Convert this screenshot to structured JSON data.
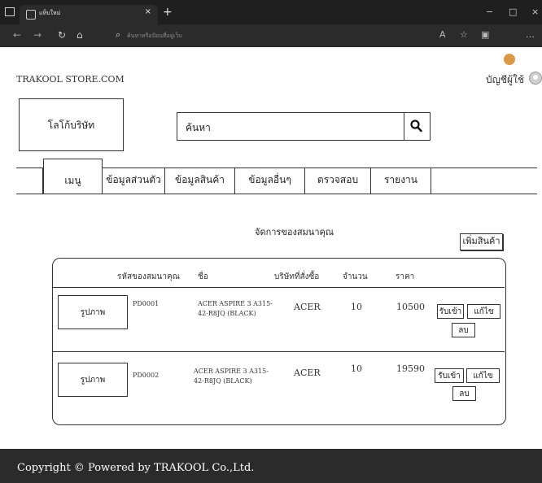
{
  "browser": {
    "tab_title": "แท็บใหม่",
    "tab_close": "×",
    "new_tab": "+",
    "address_placeholder": "ค้นหาหรือป้อนที่อยู่เว็บ",
    "window_controls": [
      "−",
      "□",
      "×"
    ]
  },
  "header": {
    "store_name": "TRAKOOL STORE.COM",
    "account_label": "บัญชีผู้ใช้"
  },
  "logo": {
    "label": "โลโก้บริษัท"
  },
  "search": {
    "value": "ค้นหา"
  },
  "nav": {
    "tabs": [
      {
        "label": "เมนู"
      },
      {
        "label": "ข้อมูลส่วนตัว"
      },
      {
        "label": "ข้อมูลสินค้า"
      },
      {
        "label": "ข้อมูลอื่นๆ"
      },
      {
        "label": "ตรวจสอบ"
      },
      {
        "label": "รายงาน"
      }
    ]
  },
  "main": {
    "heading": "จัดการของสมนาคุณ",
    "add_button": "เพิ่มสินค้า",
    "columns": [
      "รหัสของสมนาคุณ",
      "ชื่อ",
      "บริษัทที่สั่งซื้อ",
      "จำนวน",
      "ราคา"
    ],
    "rows": [
      {
        "image": "รูปภาพ",
        "code": "PD0001",
        "name": "ACER ASPIRE 3 A315-42-R8JQ (BLACK)",
        "company": "ACER",
        "quantity": "10",
        "price": "10500"
      },
      {
        "image": "รูปภาพ",
        "code": "PD0002",
        "name": "ACER ASPIRE 3 A315-42-R8JQ (BLACK)",
        "company": "ACER",
        "quantity": "10",
        "price": "19590"
      }
    ],
    "actions": {
      "receive": "รับเข้า",
      "edit": "แก้ไข",
      "delete": "ลบ"
    }
  },
  "footer": {
    "text": "Copyright © Powered by TRAKOOL Co.,Ltd."
  }
}
